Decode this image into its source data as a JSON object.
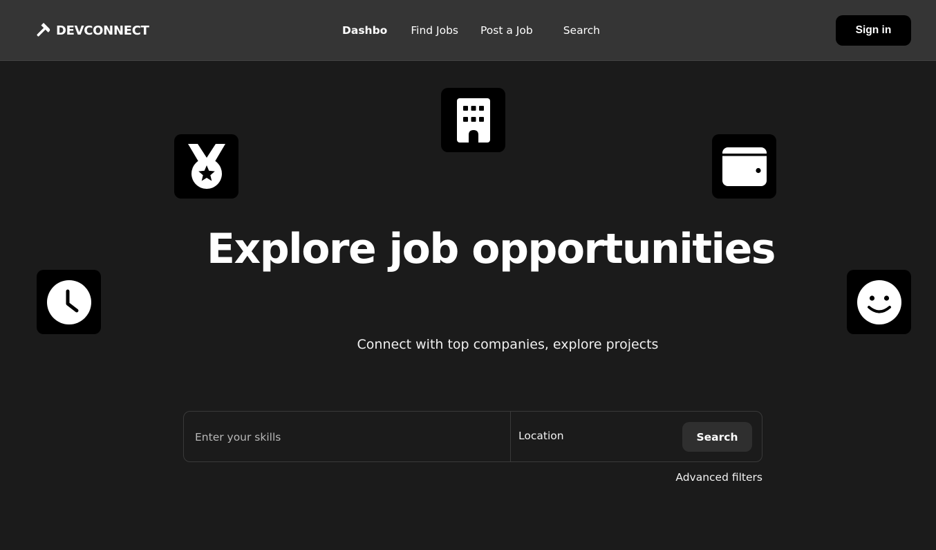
{
  "brand": {
    "name": "DEVCONNECT",
    "icon": "hammer-icon"
  },
  "nav": {
    "links": [
      {
        "label": "Dashbo",
        "active": true
      },
      {
        "label": "Find Jobs",
        "active": false
      },
      {
        "label": "Post a Job",
        "active": false
      },
      {
        "label": "Search",
        "active": false
      }
    ],
    "signin_label": "Sign in"
  },
  "hero": {
    "title": "Explore job opportunities",
    "subtitle": "Connect with top companies, explore projects",
    "tiles": [
      "building-icon",
      "medal-icon",
      "wallet-icon",
      "clock-icon",
      "smiley-icon"
    ]
  },
  "search": {
    "skills_placeholder": "Enter your skills",
    "location_label": "Location",
    "button_label": "Search",
    "advanced_label": "Advanced filters"
  },
  "colors": {
    "background": "#1b1b1b",
    "navbar": "#353535",
    "tile": "#000000",
    "button": "#2f2f2f",
    "text": "#ffffff"
  }
}
